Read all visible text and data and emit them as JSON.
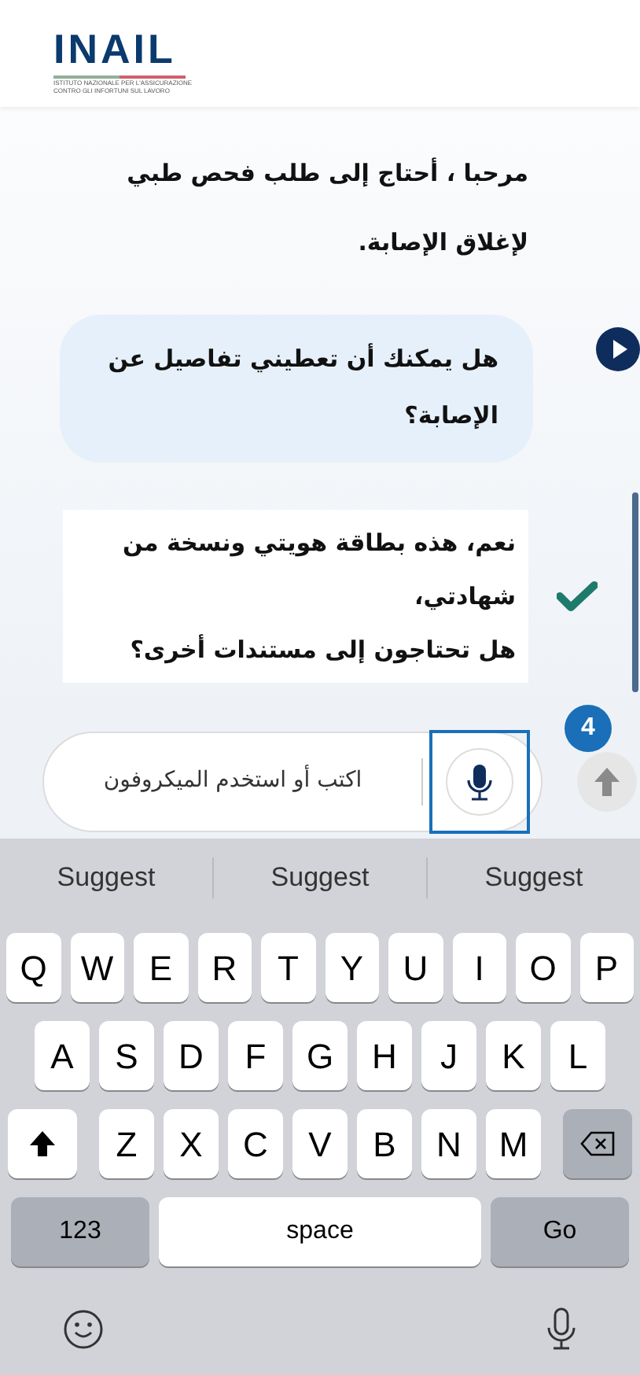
{
  "header": {
    "logo_text": "INAIL",
    "logo_subtitle_lines": [
      "ISTITUTO NAZIONALE PER L'ASSICURAZIONE",
      "CONTRO GLI INFORTUNI SUL LAVORO"
    ]
  },
  "messages": [
    {
      "kind": "plain",
      "text": "مرحبا ، أحتاج إلى طلب فحص طبي لإغلاق الإصابة."
    },
    {
      "kind": "bubble",
      "text": "هل يمكنك أن تعطيني تفاصيل عن الإصابة؟"
    },
    {
      "kind": "confirmed",
      "lines": [
        "نعم، هذه بطاقة هويتي ونسخة من",
        "شهادتي،",
        "هل تحتاجون إلى مستندات أخرى؟"
      ]
    }
  ],
  "composer": {
    "placeholder": "اكتب أو استخدم الميكروفون",
    "mic_highlighted": true,
    "badge": "4"
  },
  "keyboard": {
    "suggestions": [
      "Suggest",
      "Suggest",
      "Suggest"
    ],
    "rows": [
      [
        {
          "kind": "char",
          "label": "P"
        },
        {
          "kind": "char",
          "label": "O"
        },
        {
          "kind": "char",
          "label": "I"
        },
        {
          "kind": "char",
          "label": "U"
        },
        {
          "kind": "char",
          "label": "Y"
        },
        {
          "kind": "char",
          "label": "T"
        },
        {
          "kind": "char",
          "label": "R"
        },
        {
          "kind": "char",
          "label": "E"
        },
        {
          "kind": "char",
          "label": "W"
        },
        {
          "kind": "char",
          "label": "Q"
        }
      ],
      [
        {
          "kind": "char",
          "label": "L"
        },
        {
          "kind": "char",
          "label": "K"
        },
        {
          "kind": "char",
          "label": "J"
        },
        {
          "kind": "char",
          "label": "H"
        },
        {
          "kind": "char",
          "label": "G"
        },
        {
          "kind": "char",
          "label": "F"
        },
        {
          "kind": "char",
          "label": "D"
        },
        {
          "kind": "char",
          "label": "S"
        },
        {
          "kind": "char",
          "label": "A"
        }
      ],
      [
        {
          "kind": "backspace"
        },
        {
          "kind": "char",
          "label": "M"
        },
        {
          "kind": "char",
          "label": "N"
        },
        {
          "kind": "char",
          "label": "B"
        },
        {
          "kind": "char",
          "label": "V"
        },
        {
          "kind": "char",
          "label": "C"
        },
        {
          "kind": "char",
          "label": "X"
        },
        {
          "kind": "char",
          "label": "Z"
        },
        {
          "kind": "shift"
        }
      ]
    ],
    "bottom_row": [
      {
        "kind": "mode",
        "label": "Go"
      },
      {
        "kind": "space",
        "label": "space"
      },
      {
        "kind": "mode",
        "label": "123"
      }
    ]
  }
}
